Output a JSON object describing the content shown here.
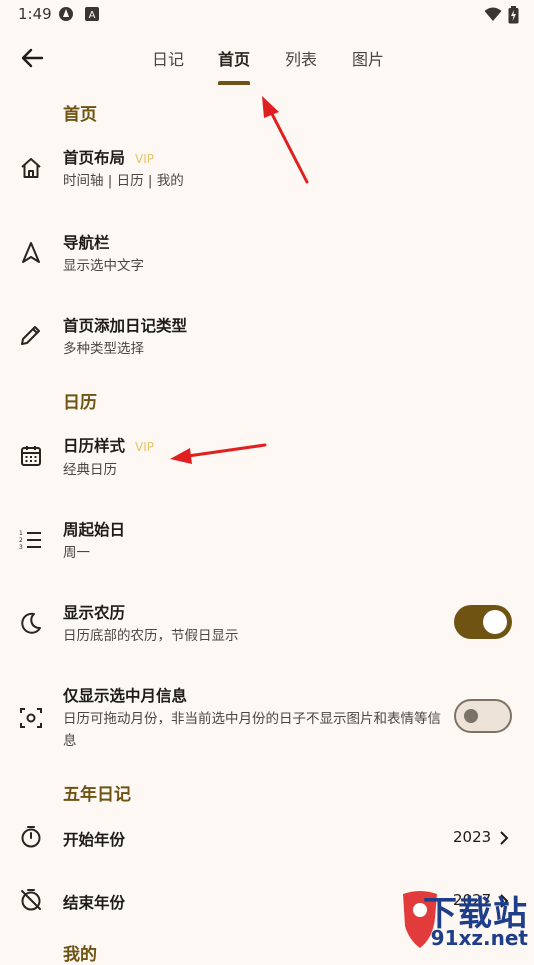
{
  "status_bar": {
    "time": "1:49"
  },
  "tabs": [
    {
      "label": "日记"
    },
    {
      "label": "首页"
    },
    {
      "label": "列表"
    },
    {
      "label": "图片"
    }
  ],
  "sections": {
    "home": "首页",
    "calendar": "日历",
    "five_year": "五年日记",
    "mine": "我的"
  },
  "items": {
    "home_layout": {
      "title": "首页布局",
      "vip": "VIP",
      "subtitle": "时间轴 | 日历 | 我的"
    },
    "nav_bar": {
      "title": "导航栏",
      "subtitle": "显示选中文字"
    },
    "add_diary_type": {
      "title": "首页添加日记类型",
      "subtitle": "多种类型选择"
    },
    "calendar_style": {
      "title": "日历样式",
      "vip": "VIP",
      "subtitle": "经典日历"
    },
    "week_start": {
      "title": "周起始日",
      "subtitle": "周一"
    },
    "lunar": {
      "title": "显示农历",
      "subtitle": "日历底部的农历，节假日显示",
      "enabled": true
    },
    "selected_month_only": {
      "title": "仅显示选中月信息",
      "subtitle": "日历可拖动月份，非当前选中月份的日子不显示图片和表情等信息",
      "enabled": false
    },
    "start_year": {
      "title": "开始年份",
      "value": "2023"
    },
    "end_year": {
      "title": "结束年份",
      "value": "2027"
    }
  },
  "watermark": {
    "big": "下载站",
    "small": "91xz.net"
  },
  "colors": {
    "accent": "#6e5313",
    "background": "#fdf8f4",
    "vip": "#e3c56a",
    "arrow": "#e02020"
  }
}
